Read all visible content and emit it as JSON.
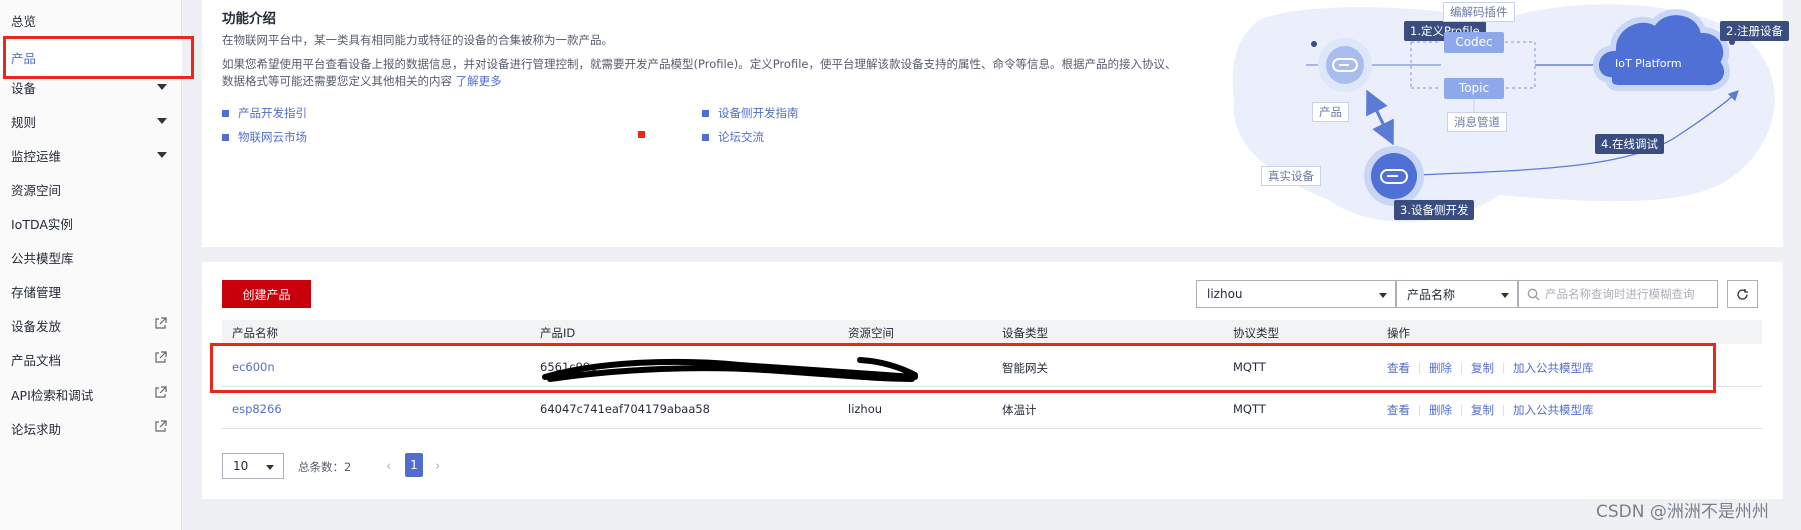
{
  "sidebar": {
    "items": [
      {
        "label": "总览"
      },
      {
        "label": "产品"
      },
      {
        "label": "设备"
      },
      {
        "label": "规则"
      },
      {
        "label": "监控运维"
      },
      {
        "label": "资源空间"
      },
      {
        "label": "IoTDA实例"
      },
      {
        "label": "公共模型库"
      },
      {
        "label": "存储管理"
      },
      {
        "label": "设备发放"
      },
      {
        "label": "产品文档"
      },
      {
        "label": "API检索和调试"
      },
      {
        "label": "论坛求助"
      }
    ]
  },
  "intro": {
    "title": "功能介绍",
    "p1": "在物联网平台中，某一类具有相同能力或特征的设备的合集被称为一款产品。",
    "p2": "如果您希望使用平台查看设备上报的数据信息，并对设备进行管理控制，就需要开发产品模型(Profile)。定义Profile，使平台理解该款设备支持的属性、命令等信息。根据产品的接入协议、数据格式等可能还需要您定义其他相关的内容",
    "learn_more": "了解更多",
    "links": [
      "产品开发指引",
      "设备侧开发指南",
      "物联网云市场",
      "论坛交流"
    ]
  },
  "diagram": {
    "step1": "1.定义Profile",
    "step2": "2.注册设备",
    "step3": "3.设备侧开发",
    "step4": "4.在线调试",
    "codec_plugin": "编解码插件",
    "codec": "Codec",
    "topic": "Topic",
    "message_pipe": "消息管道",
    "product": "产品",
    "real_device": "真实设备",
    "platform": "IoT Platform"
  },
  "toolbar": {
    "create_button": "创建产品",
    "space_select": "lizhou",
    "field_select": "产品名称",
    "search_placeholder": "产品名称查询时进行模糊查询"
  },
  "table": {
    "headers": [
      "产品名称",
      "产品ID",
      "资源空间",
      "设备类型",
      "协议类型",
      "操作"
    ],
    "rows": [
      {
        "name": "ec600n",
        "id": "6561c99c",
        "space": "",
        "type": "智能网关",
        "protocol": "MQTT"
      },
      {
        "name": "esp8266",
        "id": "64047c741eaf704179abaa58",
        "space": "lizhou",
        "type": "体温计",
        "protocol": "MQTT"
      }
    ],
    "ops": [
      "查看",
      "删除",
      "复制",
      "加入公共模型库"
    ]
  },
  "pagination": {
    "page_size": "10",
    "total": "总条数：2",
    "current_page": "1"
  },
  "watermark": "CSDN @洲洲不是州州"
}
